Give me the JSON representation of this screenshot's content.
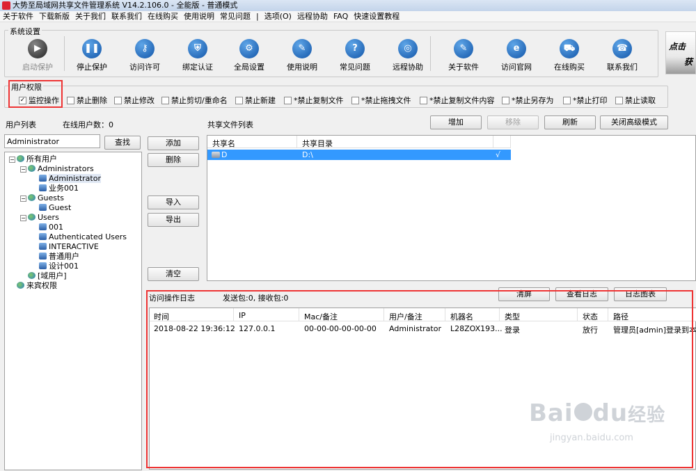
{
  "window": {
    "title": "大势至局域网共享文件管理系统 V14.2.106.0 - 全能版 - 普通模式"
  },
  "menu": [
    "关于软件",
    "下载新版",
    "关于我们",
    "联系我们",
    "在线购买",
    "使用说明",
    "常见问题",
    "|",
    "选项(O)",
    "远程协助",
    "FAQ",
    "快速设置教程"
  ],
  "toolbar": {
    "group_label": "系统设置",
    "buttons": [
      {
        "label": "启动保护",
        "icon": "play-icon",
        "glyph": "▶",
        "enabled": false
      },
      {
        "label": "停止保护",
        "icon": "pause-icon",
        "glyph": "❚❚",
        "enabled": true
      },
      {
        "label": "访问许可",
        "icon": "key-icon",
        "glyph": "⚷",
        "enabled": true
      },
      {
        "label": "绑定认证",
        "icon": "shield-icon",
        "glyph": "⛨",
        "enabled": true
      },
      {
        "label": "全局设置",
        "icon": "gear-icon",
        "glyph": "⚙",
        "enabled": true
      },
      {
        "label": "使用说明",
        "icon": "graduation-cap-icon",
        "glyph": "✎",
        "enabled": true
      },
      {
        "label": "常见问题",
        "icon": "question-icon",
        "glyph": "?",
        "enabled": true
      },
      {
        "label": "远程协助",
        "icon": "globe-icon",
        "glyph": "◎",
        "enabled": true
      },
      {
        "label": "关于软件",
        "icon": "info-icon",
        "glyph": "✎",
        "enabled": true
      },
      {
        "label": "访问官网",
        "icon": "ie-icon",
        "glyph": "e",
        "enabled": true
      },
      {
        "label": "在线购买",
        "icon": "cart-icon",
        "glyph": "⛟",
        "enabled": true
      },
      {
        "label": "联系我们",
        "icon": "phone-icon",
        "glyph": "☎",
        "enabled": true
      }
    ],
    "banner_text_1": "点击",
    "banner_text_2": "获"
  },
  "permissions": {
    "group_label": "用户权限",
    "items": [
      {
        "label": "监控操作",
        "checked": true
      },
      {
        "label": "禁止删除",
        "checked": false
      },
      {
        "label": "禁止修改",
        "checked": false
      },
      {
        "label": "禁止剪切/重命名",
        "checked": false
      },
      {
        "label": "禁止新建",
        "checked": false
      },
      {
        "label": "*禁止复制文件",
        "checked": false
      },
      {
        "label": "*禁止拖拽文件",
        "checked": false
      },
      {
        "label": "*禁止复制文件内容",
        "checked": false
      },
      {
        "label": "*禁止另存为",
        "checked": false
      },
      {
        "label": "*禁止打印",
        "checked": false
      },
      {
        "label": "禁止读取",
        "checked": false
      }
    ]
  },
  "user_list": {
    "label": "用户列表",
    "online_count": "在线用户数：0",
    "search_value": "Administrator",
    "search_button": "查找",
    "tree": [
      {
        "label": "所有用户",
        "level": 0,
        "type": "globe",
        "expander": "−"
      },
      {
        "label": "Administrators",
        "level": 1,
        "type": "globe",
        "expander": "−"
      },
      {
        "label": "Administrator",
        "level": 2,
        "type": "user",
        "selected": true
      },
      {
        "label": "业务001",
        "level": 2,
        "type": "user"
      },
      {
        "label": "Guests",
        "level": 1,
        "type": "globe",
        "expander": "−"
      },
      {
        "label": "Guest",
        "level": 2,
        "type": "user"
      },
      {
        "label": "Users",
        "level": 1,
        "type": "globe",
        "expander": "−"
      },
      {
        "label": "001",
        "level": 2,
        "type": "user"
      },
      {
        "label": "Authenticated Users",
        "level": 2,
        "type": "user"
      },
      {
        "label": "INTERACTIVE",
        "level": 2,
        "type": "user"
      },
      {
        "label": "普通用户",
        "level": 2,
        "type": "user"
      },
      {
        "label": "设计001",
        "level": 2,
        "type": "user"
      },
      {
        "label": "[域用户]",
        "level": 1,
        "type": "globe"
      },
      {
        "label": "来宾权限",
        "level": 0,
        "type": "globe"
      }
    ]
  },
  "side_buttons": {
    "add": "添加",
    "delete": "删除",
    "import": "导入",
    "export": "导出",
    "clear": "清空"
  },
  "share_list": {
    "label": "共享文件列表",
    "buttons": {
      "add": "增加",
      "remove": "移除",
      "refresh": "刷新",
      "close_advanced": "关闭高级模式"
    },
    "columns": [
      "共享名",
      "共享目录"
    ],
    "rows": [
      {
        "name": "D",
        "path": "D:\\",
        "check": "√"
      }
    ]
  },
  "log": {
    "label": "访问操作日志",
    "packets": "发送包:0, 接收包:0",
    "buttons": {
      "clear": "清屏",
      "view": "查看日志",
      "chart": "日志图表"
    },
    "columns": [
      "时间",
      "IP",
      "Mac/备注",
      "用户/备注",
      "机器名",
      "类型",
      "状态",
      "路径"
    ],
    "rows": [
      [
        "2018-08-22 19:36:12",
        "127.0.0.1",
        "00-00-00-00-00-00",
        "Administrator",
        "L28ZOX193...",
        "登录",
        "放行",
        "管理员[admin]登录到本系"
      ]
    ]
  },
  "watermark": {
    "text_1": "Bai",
    "text_2": "du",
    "text_3": "经验",
    "url": "jingyan.baidu.com"
  }
}
